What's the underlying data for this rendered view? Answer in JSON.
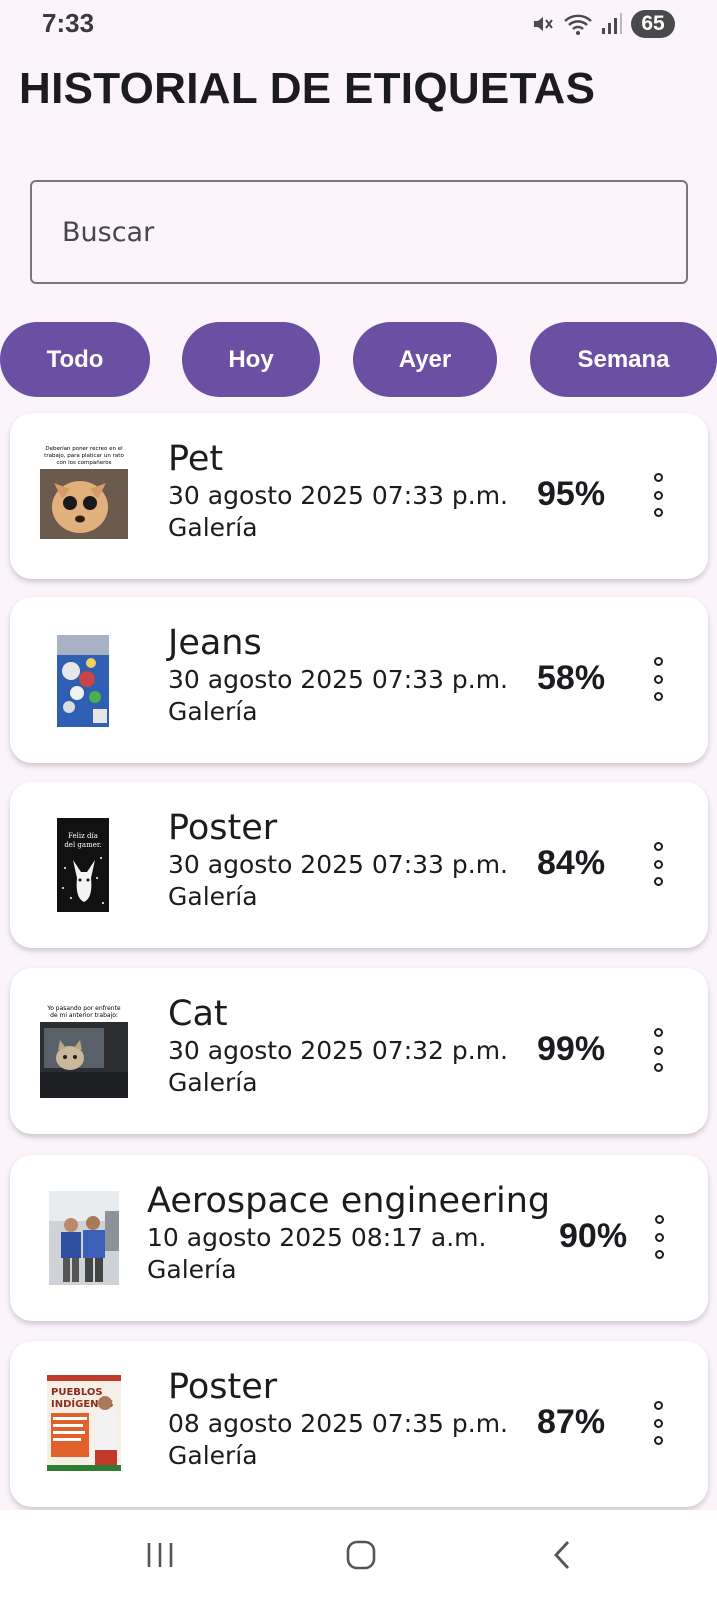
{
  "status_bar": {
    "time": "7:33",
    "battery": "65"
  },
  "header": {
    "title": "HISTORIAL DE ETIQUETAS"
  },
  "search": {
    "placeholder": "Buscar"
  },
  "filters": [
    "Todo",
    "Hoy",
    "Ayer",
    "Semana"
  ],
  "items": [
    {
      "label": "Pet",
      "date": "30 agosto 2025 07:33 p.m.",
      "source": "Galería",
      "confidence": "95%",
      "thumb_caption": "Deberían poner recreo en el trabajo, para platicar un rato con los compañeros"
    },
    {
      "label": "Jeans",
      "date": "30 agosto 2025 07:33 p.m.",
      "source": "Galería",
      "confidence": "58%"
    },
    {
      "label": "Poster",
      "date": "30 agosto 2025 07:33 p.m.",
      "source": "Galería",
      "confidence": "84%",
      "thumb_caption": "Feliz día del gamer."
    },
    {
      "label": "Cat",
      "date": "30 agosto 2025 07:32 p.m.",
      "source": "Galería",
      "confidence": "99%",
      "thumb_caption": "Yo pasando por enfrente de mi anterior trabajo:"
    },
    {
      "label": "Aerospace engineering",
      "date": "10 agosto 2025 08:17 a.m.",
      "source": "Galería",
      "confidence": "90%"
    },
    {
      "label": "Poster",
      "date": "08 agosto 2025 07:35 p.m.",
      "source": "Galería",
      "confidence": "87%",
      "thumb_caption": "PUEBLOS INDÍGENAS"
    }
  ],
  "colors": {
    "accent": "#6a4fa3",
    "background": "#fbf4fb",
    "card": "#ffffff"
  },
  "icons": [
    "mute-icon",
    "wifi-icon",
    "signal-icon",
    "more-vert-icon",
    "recents-icon",
    "home-icon",
    "back-icon"
  ]
}
